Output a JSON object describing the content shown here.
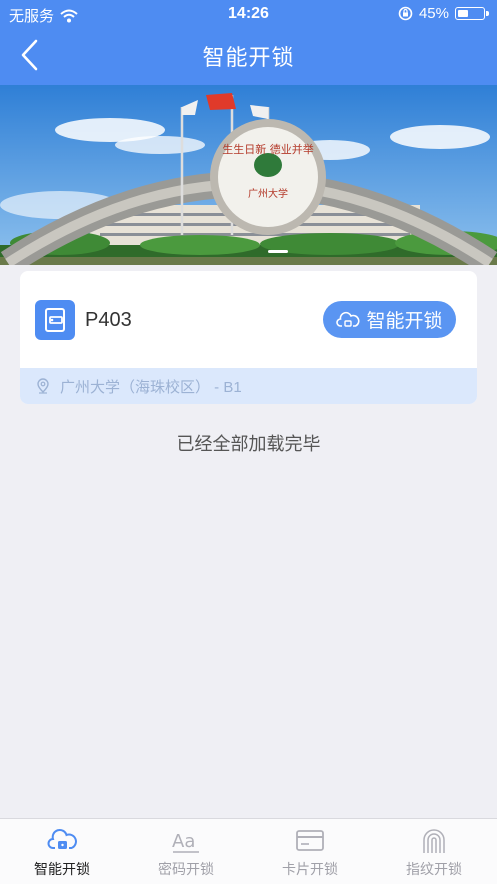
{
  "status_bar": {
    "carrier": "无服务",
    "time": "14:26",
    "battery": "45%",
    "battery_level": 0.45
  },
  "header": {
    "title": "智能开锁",
    "back_icon": "chevron-left-icon"
  },
  "banner": {
    "image": "campus-gate-photo",
    "gate_text": "广州大学",
    "slogan": "生生日新 德业并举"
  },
  "locks": [
    {
      "name": "P403",
      "button_label": "智能开锁",
      "location": "广州大学（海珠校区） - B1"
    }
  ],
  "list_end_text": "已经全部加载完毕",
  "tabs": [
    {
      "label": "智能开锁",
      "icon": "cloud-lock-icon",
      "active": true
    },
    {
      "label": "密码开锁",
      "icon": "password-icon",
      "active": false
    },
    {
      "label": "卡片开锁",
      "icon": "card-icon",
      "active": false
    },
    {
      "label": "指纹开锁",
      "icon": "fingerprint-icon",
      "active": false
    }
  ],
  "colors": {
    "primary": "#4e8cf2",
    "location_bg": "#dbe8fc",
    "page_bg": "#efeff4"
  }
}
